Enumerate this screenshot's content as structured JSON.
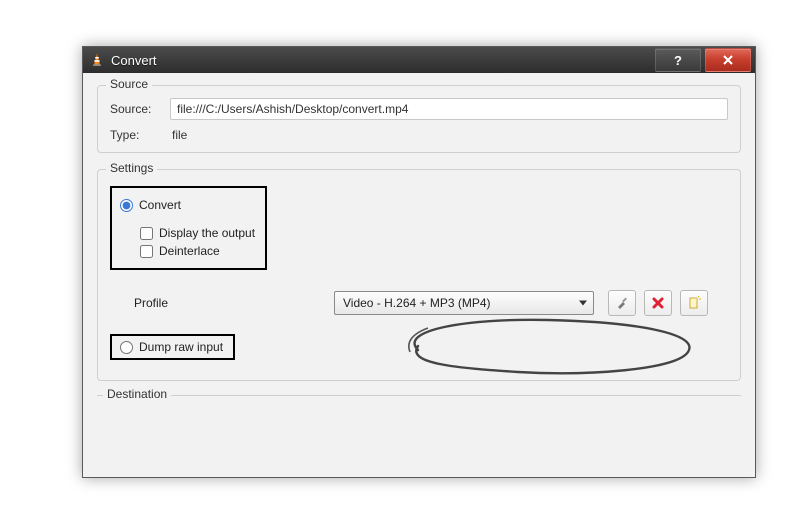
{
  "window": {
    "title": "Convert",
    "help_label": "?",
    "close_aria": "Close"
  },
  "source_group": {
    "legend": "Source",
    "source_label": "Source:",
    "source_value": "file:///C:/Users/Ashish/Desktop/convert.mp4",
    "type_label": "Type:",
    "type_value": "file"
  },
  "settings_group": {
    "legend": "Settings",
    "convert_radio": "Convert",
    "display_output": "Display the output",
    "deinterlace": "Deinterlace",
    "profile_label": "Profile",
    "profile_selected": "Video - H.264 + MP3 (MP4)",
    "dump_raw": "Dump raw input"
  },
  "icons": {
    "tools": "tools",
    "delete": "delete",
    "new": "new"
  },
  "destination_group": {
    "legend": "Destination"
  }
}
